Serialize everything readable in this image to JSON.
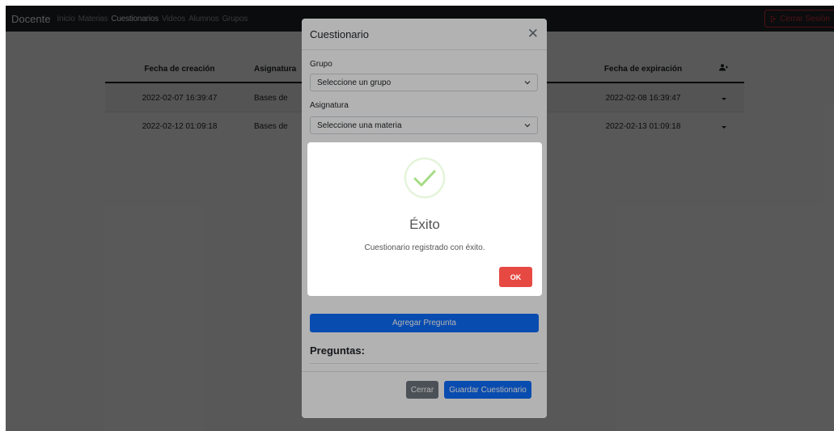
{
  "navbar": {
    "brand": "Docente",
    "links": [
      "Inicio",
      "Materias",
      "Cuestionarios",
      "Videos",
      "Alumnos",
      "Grupos"
    ],
    "active_index": 2,
    "logout_label": "Cerrar Sesión"
  },
  "table": {
    "headers": [
      "Fecha de creación",
      "Asignatura",
      "",
      "Fecha de expiración",
      ""
    ],
    "rows": [
      {
        "created": "2022-02-07 16:39:47",
        "subject": "Bases de",
        "expires": "2022-02-08 16:39:47"
      },
      {
        "created": "2022-02-12 01:09:18",
        "subject": "Bases de",
        "expires": "2022-02-13 01:09:18"
      }
    ]
  },
  "modal": {
    "title": "Cuestionario",
    "grupo_label": "Grupo",
    "grupo_value": "Seleccione un grupo",
    "asignatura_label": "Asignatura",
    "asignatura_value": "Seleccione una materia",
    "add_question_label": "Agregar Pregunta",
    "questions_heading": "Preguntas:",
    "close_label": "Cerrar",
    "save_label": "Guardar Cuestionario"
  },
  "alert": {
    "icon": "success-check-icon",
    "title": "Éxito",
    "text": "Cuestionario registrado con éxito.",
    "ok_label": "OK"
  },
  "colors": {
    "navbar": "#212529",
    "primary": "#0d6efd",
    "danger": "#dc3545",
    "ok_button": "#e64942",
    "success": "#a5dc86"
  }
}
